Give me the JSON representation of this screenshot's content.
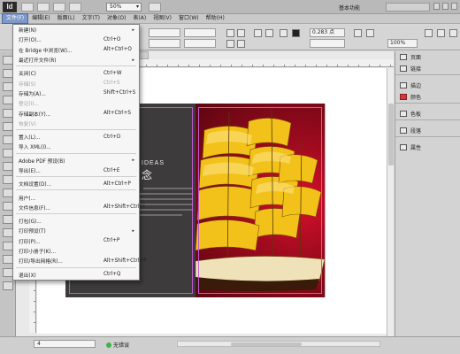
{
  "app": {
    "logo": "Id",
    "zoom": "50%",
    "workspace": "基本功能",
    "arrow": "▾"
  },
  "menubar": {
    "items": [
      {
        "label": "文件(F)",
        "active": true
      },
      {
        "label": "编辑(E)"
      },
      {
        "label": "版面(L)"
      },
      {
        "label": "文字(T)"
      },
      {
        "label": "对象(O)"
      },
      {
        "label": "表(A)"
      },
      {
        "label": "视图(V)"
      },
      {
        "label": "窗口(W)"
      },
      {
        "label": "帮助(H)"
      }
    ]
  },
  "controlbar": {
    "stroke_weight": "0.283 点",
    "percent": "100%"
  },
  "file_menu": {
    "items": [
      {
        "label": "新建(N)",
        "shortcut": "",
        "sub": "▸",
        "enabled": true
      },
      {
        "label": "打开(O)...",
        "shortcut": "Ctrl+O",
        "enabled": true
      },
      {
        "label": "在 Bridge 中浏览(W)...",
        "shortcut": "Alt+Ctrl+O",
        "enabled": true
      },
      {
        "label": "最近打开文件(R)",
        "shortcut": "",
        "sub": "▸",
        "enabled": true
      },
      {
        "sep": true
      },
      {
        "label": "关闭(C)",
        "shortcut": "Ctrl+W",
        "enabled": true
      },
      {
        "label": "存储(S)",
        "shortcut": "Ctrl+S",
        "enabled": false
      },
      {
        "label": "存储为(A)...",
        "shortcut": "Shift+Ctrl+S",
        "enabled": true
      },
      {
        "label": "登记(I)...",
        "shortcut": "",
        "enabled": false
      },
      {
        "label": "存储副本(Y)...",
        "shortcut": "Alt+Ctrl+S",
        "enabled": true
      },
      {
        "label": "恢复(V)",
        "shortcut": "",
        "enabled": false
      },
      {
        "sep": true
      },
      {
        "label": "置入(L)...",
        "shortcut": "Ctrl+D",
        "enabled": true
      },
      {
        "label": "导入 XML(I)...",
        "shortcut": "",
        "enabled": true
      },
      {
        "sep": true
      },
      {
        "label": "Adobe PDF 预设(B)",
        "shortcut": "",
        "sub": "▸",
        "enabled": true
      },
      {
        "label": "导出(E)...",
        "shortcut": "Ctrl+E",
        "enabled": true
      },
      {
        "sep": true
      },
      {
        "label": "文档设置(D)...",
        "shortcut": "Alt+Ctrl+P",
        "enabled": true
      },
      {
        "sep": true
      },
      {
        "label": "用户(...",
        "shortcut": "",
        "enabled": true
      },
      {
        "label": "文件信息(F)...",
        "shortcut": "Alt+Shift+Ctrl+I",
        "enabled": true
      },
      {
        "sep": true
      },
      {
        "label": "打包(G)...",
        "shortcut": "",
        "enabled": true
      },
      {
        "label": "打印预设(T)",
        "shortcut": "",
        "sub": "▸",
        "enabled": true
      },
      {
        "label": "打印(P)...",
        "shortcut": "Ctrl+P",
        "enabled": true
      },
      {
        "label": "打印小册子(K)...",
        "shortcut": "",
        "enabled": true
      },
      {
        "label": "打印/导出网格(R)...",
        "shortcut": "Alt+Shift+Ctrl+P",
        "enabled": true
      },
      {
        "sep": true
      },
      {
        "label": "退出(X)",
        "shortcut": "Ctrl+Q",
        "enabled": true
      }
    ]
  },
  "panels": {
    "items": [
      {
        "label": "页面"
      },
      {
        "label": "链接"
      },
      {
        "sep": true
      },
      {
        "label": "描边"
      },
      {
        "label": "颜色",
        "red": true
      },
      {
        "sep": true
      },
      {
        "label": "色板"
      },
      {
        "sep": true
      },
      {
        "label": "段落"
      },
      {
        "sep": true
      },
      {
        "label": "属性"
      }
    ]
  },
  "document": {
    "ideas": "IDEAS",
    "ideas_cn": "念"
  },
  "status": {
    "page": "4",
    "preflight": "无错误"
  },
  "colors": {
    "accent": "#7d98c7",
    "page_dark": "#3d3b3c",
    "page_red": "#c8102d"
  }
}
